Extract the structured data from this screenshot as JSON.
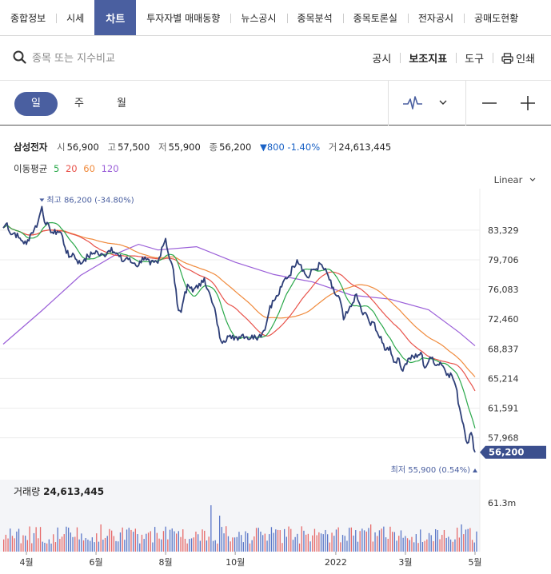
{
  "tabs": [
    {
      "label": "종합정보",
      "active": false
    },
    {
      "label": "시세",
      "active": false
    },
    {
      "label": "차트",
      "active": true
    },
    {
      "label": "투자자별 매매동향",
      "active": false
    },
    {
      "label": "뉴스공시",
      "active": false
    },
    {
      "label": "종목분석",
      "active": false
    },
    {
      "label": "종목토론실",
      "active": false
    },
    {
      "label": "전자공시",
      "active": false
    },
    {
      "label": "공매도현황",
      "active": false
    }
  ],
  "search": {
    "placeholder": "종목 또는 지수비교",
    "icon": "search-icon"
  },
  "toplinks": {
    "notice": "공시",
    "indicator": "보조지표",
    "tools": "도구",
    "print": "인쇄"
  },
  "periods": {
    "day": "일",
    "week": "주",
    "month": "월",
    "active": "day"
  },
  "stock": {
    "name": "삼성전자",
    "open_label": "시",
    "open": "56,900",
    "high_label": "고",
    "high": "57,500",
    "low_label": "저",
    "low": "55,900",
    "close_label": "종",
    "close": "56,200",
    "change": "▼800 -1.40%",
    "volume_label": "거",
    "volume": "24,613,445"
  },
  "ma": {
    "label": "이동평균",
    "periods": [
      "5",
      "20",
      "60",
      "120"
    ],
    "colors": [
      "#2aa84a",
      "#e8524a",
      "#f08a3c",
      "#9a5ed8"
    ]
  },
  "scale_mode": "Linear",
  "chart_data": {
    "type": "line",
    "y_axis_ticks": [
      "83,329",
      "79,706",
      "76,083",
      "72,460",
      "68,837",
      "65,214",
      "61,591",
      "57,968"
    ],
    "ylim": [
      55000,
      88000
    ],
    "last_price_label": "56,200",
    "high_annotation": "최고 86,200 (-34.80%)",
    "low_annotation": "최저 55,900 (0.54%)",
    "x_ticks": [
      "4월",
      "6월",
      "8월",
      "10월",
      "2022",
      "3월",
      "5월"
    ],
    "x_tick_index": [
      6,
      24,
      42,
      60,
      86,
      104,
      122
    ],
    "price_anchors": [
      [
        0,
        83600
      ],
      [
        1,
        84200
      ],
      [
        2,
        82800
      ],
      [
        3,
        83000
      ],
      [
        4,
        82400
      ],
      [
        5,
        82000
      ],
      [
        6,
        81600
      ],
      [
        7,
        82800
      ],
      [
        8,
        83400
      ],
      [
        9,
        84300
      ],
      [
        10,
        86200
      ],
      [
        11,
        84000
      ],
      [
        12,
        83600
      ],
      [
        13,
        82900
      ],
      [
        14,
        83200
      ],
      [
        15,
        83000
      ],
      [
        16,
        81200
      ],
      [
        17,
        80000
      ],
      [
        18,
        80500
      ],
      [
        19,
        79700
      ],
      [
        20,
        79200
      ],
      [
        21,
        79800
      ],
      [
        22,
        80100
      ],
      [
        23,
        80400
      ],
      [
        24,
        80800
      ],
      [
        25,
        80200
      ],
      [
        26,
        80300
      ],
      [
        27,
        80700
      ],
      [
        28,
        81200
      ],
      [
        29,
        80500
      ],
      [
        30,
        80100
      ],
      [
        31,
        79500
      ],
      [
        32,
        80000
      ],
      [
        33,
        79400
      ],
      [
        34,
        79300
      ],
      [
        35,
        79000
      ],
      [
        36,
        80000
      ],
      [
        37,
        79700
      ],
      [
        38,
        79100
      ],
      [
        39,
        79400
      ],
      [
        40,
        79300
      ],
      [
        41,
        81200
      ],
      [
        42,
        82300
      ],
      [
        43,
        79800
      ],
      [
        44,
        78500
      ],
      [
        45,
        74300
      ],
      [
        46,
        73300
      ],
      [
        47,
        75800
      ],
      [
        48,
        76500
      ],
      [
        49,
        75800
      ],
      [
        50,
        76600
      ],
      [
        51,
        76500
      ],
      [
        52,
        77500
      ],
      [
        53,
        76000
      ],
      [
        54,
        74500
      ],
      [
        55,
        73000
      ],
      [
        56,
        70200
      ],
      [
        57,
        69800
      ],
      [
        58,
        70400
      ],
      [
        59,
        70100
      ],
      [
        60,
        70300
      ],
      [
        61,
        70300
      ],
      [
        62,
        70600
      ],
      [
        63,
        70300
      ],
      [
        64,
        70100
      ],
      [
        65,
        70500
      ],
      [
        66,
        70300
      ],
      [
        67,
        70800
      ],
      [
        68,
        71800
      ],
      [
        69,
        74100
      ],
      [
        70,
        74700
      ],
      [
        71,
        75300
      ],
      [
        72,
        76400
      ],
      [
        73,
        77500
      ],
      [
        74,
        77800
      ],
      [
        75,
        78900
      ],
      [
        76,
        79700
      ],
      [
        77,
        79100
      ],
      [
        78,
        78000
      ],
      [
        79,
        77500
      ],
      [
        80,
        78500
      ],
      [
        81,
        78600
      ],
      [
        82,
        79200
      ],
      [
        83,
        78500
      ],
      [
        84,
        77800
      ],
      [
        85,
        76300
      ],
      [
        86,
        75400
      ],
      [
        87,
        75000
      ],
      [
        88,
        72400
      ],
      [
        89,
        73200
      ],
      [
        90,
        74000
      ],
      [
        91,
        75400
      ],
      [
        92,
        74500
      ],
      [
        93,
        73000
      ],
      [
        94,
        73000
      ],
      [
        95,
        71700
      ],
      [
        96,
        72000
      ],
      [
        97,
        70500
      ],
      [
        98,
        69600
      ],
      [
        99,
        68700
      ],
      [
        100,
        69100
      ],
      [
        101,
        67200
      ],
      [
        102,
        67700
      ],
      [
        103,
        66300
      ],
      [
        104,
        67000
      ],
      [
        105,
        67700
      ],
      [
        106,
        67900
      ],
      [
        107,
        67800
      ],
      [
        108,
        68400
      ],
      [
        109,
        66500
      ],
      [
        110,
        67300
      ],
      [
        111,
        67800
      ],
      [
        112,
        66800
      ],
      [
        113,
        67200
      ],
      [
        114,
        66500
      ],
      [
        115,
        65800
      ],
      [
        116,
        65600
      ],
      [
        117,
        64300
      ],
      [
        118,
        61600
      ],
      [
        119,
        59600
      ],
      [
        120,
        57300
      ],
      [
        121,
        58600
      ],
      [
        122,
        56200
      ]
    ],
    "series": [
      {
        "name": "5",
        "color": "#2aa84a",
        "values": []
      },
      {
        "name": "20",
        "color": "#e8524a",
        "values": []
      },
      {
        "name": "60",
        "color": "#f08a3c",
        "values": []
      },
      {
        "name": "120",
        "color": "#9a5ed8",
        "values": [
          [
            0,
            69400
          ],
          [
            10,
            73500
          ],
          [
            20,
            77800
          ],
          [
            30,
            80600
          ],
          [
            35,
            81600
          ],
          [
            40,
            80900
          ],
          [
            50,
            81300
          ],
          [
            60,
            79400
          ],
          [
            70,
            77900
          ],
          [
            80,
            77000
          ],
          [
            90,
            75400
          ],
          [
            100,
            74900
          ],
          [
            110,
            73600
          ],
          [
            118,
            70800
          ],
          [
            122,
            69200
          ]
        ]
      }
    ],
    "volume": {
      "title": "거래량",
      "value": "24,613,445",
      "axis_label": "61.3m"
    }
  }
}
